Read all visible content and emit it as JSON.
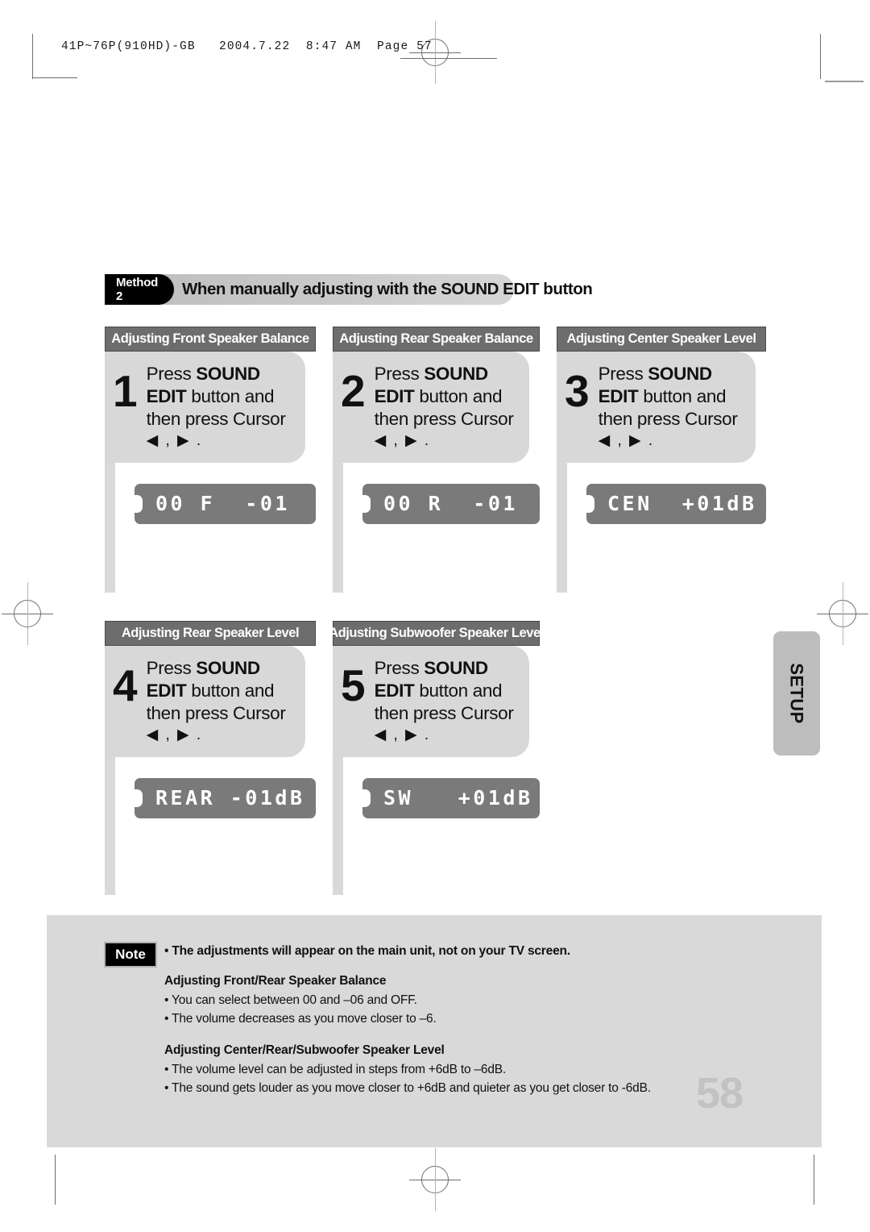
{
  "print_slug": {
    "text": "41P~76P(910HD)-GB   2004.7.22  8:47 AM  Page 57"
  },
  "method_banner": {
    "tag": "Method 2",
    "title": "When manually adjusting with the SOUND EDIT button"
  },
  "side_tab": {
    "label": "SETUP"
  },
  "steps": [
    {
      "header": "Adjusting Front Speaker Balance",
      "number": "1",
      "text_line1_plain": "Press ",
      "text_line1_bold": "SOUND",
      "text_line2_bold": "EDIT",
      "text_line2_plain": " button and",
      "text_line3": "then press Cursor",
      "arrows": "◀ , ▶ .",
      "lcd": "00 F  -01"
    },
    {
      "header": "Adjusting Rear Speaker Balance",
      "number": "2",
      "text_line1_plain": "Press ",
      "text_line1_bold": "SOUND",
      "text_line2_bold": "EDIT",
      "text_line2_plain": " button and",
      "text_line3": "then press Cursor",
      "arrows": "◀ , ▶ .",
      "lcd": "00 R  -01"
    },
    {
      "header": "Adjusting Center Speaker Level",
      "number": "3",
      "text_line1_plain": "Press ",
      "text_line1_bold": "SOUND",
      "text_line2_bold": "EDIT",
      "text_line2_plain": " button and",
      "text_line3": "then press Cursor",
      "arrows": "◀ , ▶ .",
      "lcd": "CEN  +01dB"
    },
    {
      "header": "Adjusting Rear Speaker Level",
      "number": "4",
      "text_line1_plain": "Press ",
      "text_line1_bold": "SOUND",
      "text_line2_bold": "EDIT",
      "text_line2_plain": " button and",
      "text_line3": "then press Cursor",
      "arrows": "◀ , ▶ .",
      "lcd": "REAR -01dB"
    },
    {
      "header": "Adjusting Subwoofer Speaker Level",
      "number": "5",
      "text_line1_plain": "Press ",
      "text_line1_bold": "SOUND",
      "text_line2_bold": "EDIT",
      "text_line2_plain": " button and",
      "text_line3": "then press Cursor",
      "arrows": "◀ , ▶ .",
      "lcd": "SW   +01dB"
    }
  ],
  "note": {
    "badge": "Note",
    "lead": "• The adjustments will appear on the main unit, not on your TV screen.",
    "section1_title": "Adjusting Front/Rear Speaker Balance",
    "section1_items": [
      "• You can select between 00 and –06 and OFF.",
      "• The volume decreases as you move closer to –6."
    ],
    "section2_title": "Adjusting Center/Rear/Subwoofer Speaker Level",
    "section2_items": [
      "• The volume level can be adjusted in steps from +6dB to –6dB.",
      "• The sound gets louder as you move closer to +6dB and quieter as you get closer to -6dB."
    ]
  },
  "page_number": "58"
}
